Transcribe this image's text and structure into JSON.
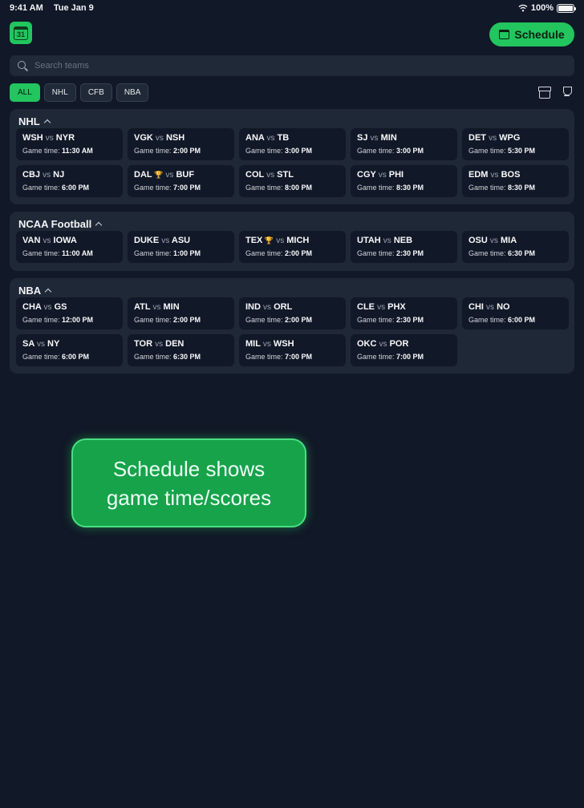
{
  "status_bar": {
    "time": "9:41 AM",
    "date": "Tue Jan 9",
    "battery": "100%"
  },
  "header": {
    "app_icon_day": "31",
    "schedule_label": "Schedule"
  },
  "search": {
    "placeholder": "Search teams"
  },
  "filters": [
    {
      "label": "ALL",
      "active": true
    },
    {
      "label": "NHL",
      "active": false
    },
    {
      "label": "CFB",
      "active": false
    },
    {
      "label": "NBA",
      "active": false
    }
  ],
  "game_time_label": "Game time:",
  "vs_label": "vs",
  "sections": [
    {
      "title": "NHL",
      "games": [
        {
          "home": "WSH",
          "away": "NYR",
          "time": "11:30 AM",
          "trophy": false
        },
        {
          "home": "VGK",
          "away": "NSH",
          "time": "2:00 PM",
          "trophy": false
        },
        {
          "home": "ANA",
          "away": "TB",
          "time": "3:00 PM",
          "trophy": false
        },
        {
          "home": "SJ",
          "away": "MIN",
          "time": "3:00 PM",
          "trophy": false
        },
        {
          "home": "DET",
          "away": "WPG",
          "time": "5:30 PM",
          "trophy": false
        },
        {
          "home": "CBJ",
          "away": "NJ",
          "time": "6:00 PM",
          "trophy": false
        },
        {
          "home": "DAL",
          "away": "BUF",
          "time": "7:00 PM",
          "trophy": true
        },
        {
          "home": "COL",
          "away": "STL",
          "time": "8:00 PM",
          "trophy": false
        },
        {
          "home": "CGY",
          "away": "PHI",
          "time": "8:30 PM",
          "trophy": false
        },
        {
          "home": "EDM",
          "away": "BOS",
          "time": "8:30 PM",
          "trophy": false
        }
      ]
    },
    {
      "title": "NCAA Football",
      "games": [
        {
          "home": "VAN",
          "away": "IOWA",
          "time": "11:00 AM",
          "trophy": false
        },
        {
          "home": "DUKE",
          "away": "ASU",
          "time": "1:00 PM",
          "trophy": false
        },
        {
          "home": "TEX",
          "away": "MICH",
          "time": "2:00 PM",
          "trophy": true
        },
        {
          "home": "UTAH",
          "away": "NEB",
          "time": "2:30 PM",
          "trophy": false
        },
        {
          "home": "OSU",
          "away": "MIA",
          "time": "6:30 PM",
          "trophy": false
        }
      ]
    },
    {
      "title": "NBA",
      "games": [
        {
          "home": "CHA",
          "away": "GS",
          "time": "12:00 PM",
          "trophy": false
        },
        {
          "home": "ATL",
          "away": "MIN",
          "time": "2:00 PM",
          "trophy": false
        },
        {
          "home": "IND",
          "away": "ORL",
          "time": "2:00 PM",
          "trophy": false
        },
        {
          "home": "CLE",
          "away": "PHX",
          "time": "2:30 PM",
          "trophy": false
        },
        {
          "home": "CHI",
          "away": "NO",
          "time": "6:00 PM",
          "trophy": false
        },
        {
          "home": "SA",
          "away": "NY",
          "time": "6:00 PM",
          "trophy": false
        },
        {
          "home": "TOR",
          "away": "DEN",
          "time": "6:30 PM",
          "trophy": false
        },
        {
          "home": "MIL",
          "away": "WSH",
          "time": "7:00 PM",
          "trophy": false
        },
        {
          "home": "OKC",
          "away": "POR",
          "time": "7:00 PM",
          "trophy": false
        }
      ]
    }
  ],
  "callout": {
    "line1": "Schedule shows",
    "line2": "game time/scores"
  },
  "colors": {
    "accent": "#22c55e",
    "background": "#111827",
    "card": "#1e2836"
  }
}
